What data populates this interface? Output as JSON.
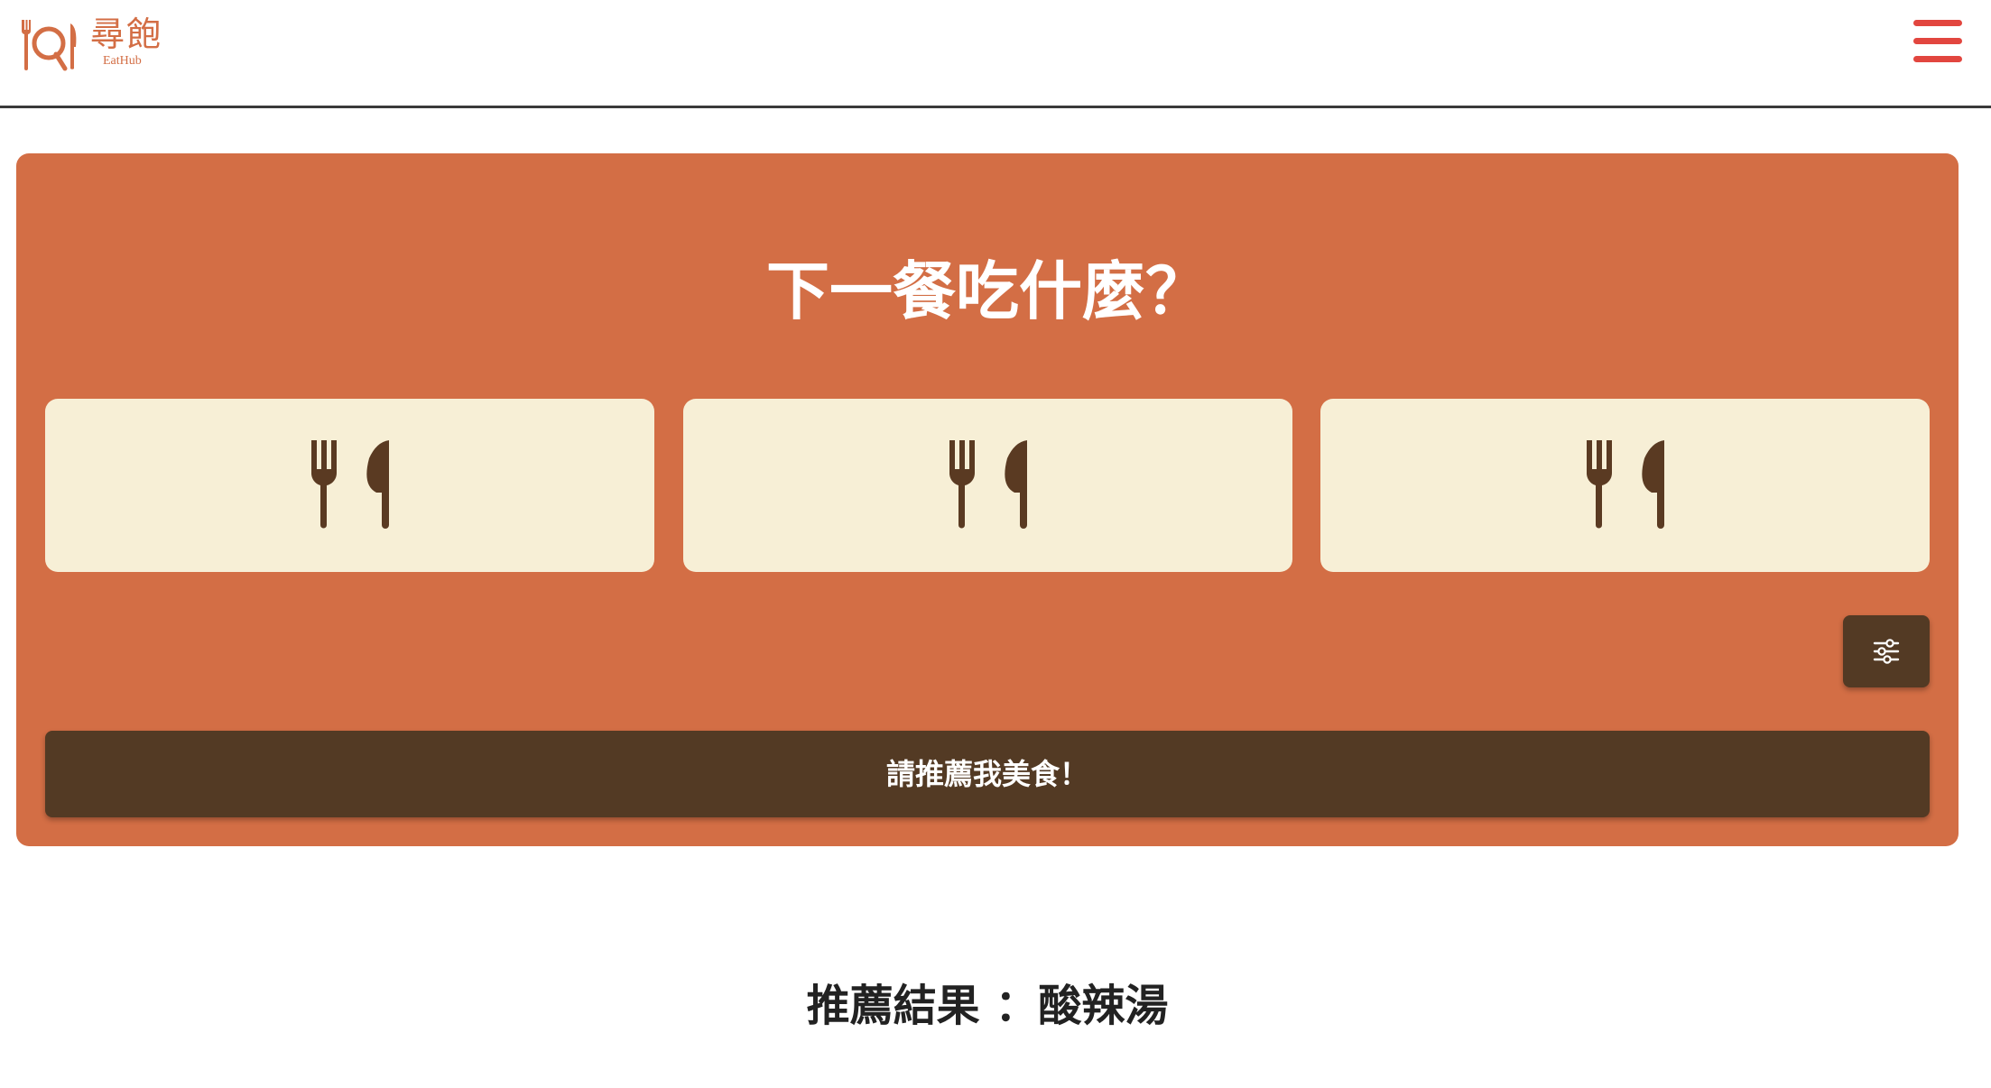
{
  "header": {
    "logo_title": "尋飽",
    "logo_subtitle": "EatHub",
    "menu_icon": "hamburger-menu-icon"
  },
  "main": {
    "question": "下一餐吃什麼？",
    "slots": [
      {
        "icon": "fork-knife-icon"
      },
      {
        "icon": "fork-knife-icon"
      },
      {
        "icon": "fork-knife-icon"
      }
    ],
    "filter_icon": "sliders-icon",
    "recommend_label": "請推薦我美食！"
  },
  "result": {
    "text": "推薦結果 ：酸辣湯"
  },
  "colors": {
    "brand": "#d36e45",
    "panel": "#d36e45",
    "slot_bg": "#f7efd6",
    "dark_brown": "#533a24",
    "menu_red": "#e2463f"
  }
}
